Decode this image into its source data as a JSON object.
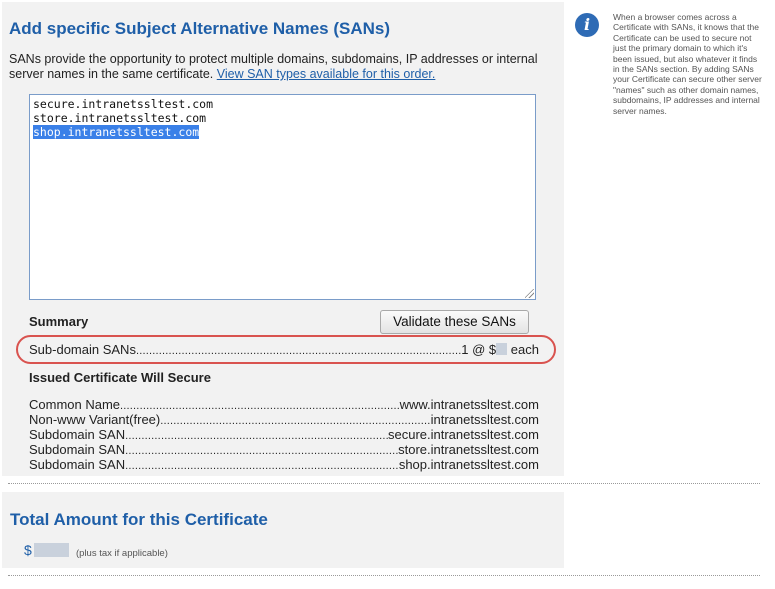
{
  "san_section": {
    "heading": "Add specific Subject Alternative Names (SANs)",
    "description": "SANs provide the opportunity to protect multiple domains, subdomains, IP addresses or internal server names in the same certificate.",
    "link_text": "View SAN types available for this order.",
    "sans": [
      "secure.intranetssltest.com",
      "store.intranetssltest.com",
      "shop.intranetssltest.com"
    ],
    "summary_label": "Summary",
    "validate_label": "Validate these SANs",
    "subdomain_summary": {
      "label": "Sub-domain SANs",
      "value_prefix": "1 @ $",
      "value_suffix": "each"
    },
    "issued_label": "Issued Certificate Will Secure",
    "issued_rows": [
      {
        "label": "Common Name",
        "value": "www.intranetssltest.com"
      },
      {
        "label": "Non-www Variant(free)",
        "value": "intranetssltest.com"
      },
      {
        "label": "Subdomain SAN",
        "value": "secure.intranetssltest.com"
      },
      {
        "label": "Subdomain SAN",
        "value": "store.intranetssltest.com"
      },
      {
        "label": "Subdomain SAN",
        "value": "shop.intranetssltest.com"
      }
    ]
  },
  "total_section": {
    "heading": "Total Amount for this Certificate",
    "currency": "$",
    "tax_note": "(plus tax if applicable)"
  },
  "sidebar": {
    "icon": "info-icon",
    "info_text": "When a browser comes across a Certificate with SANs, it knows that the Certificate can be used to secure not just the primary domain to which it's been issued, but also whatever it finds in the SANs section. By adding SANs your Certificate can secure other server \"names\" such as other domain names, subdomains, IP addresses and internal server names."
  },
  "colors": {
    "heading": "#1f5fa8",
    "highlight_oval": "#d9534f",
    "selection": "#3a80e8"
  }
}
